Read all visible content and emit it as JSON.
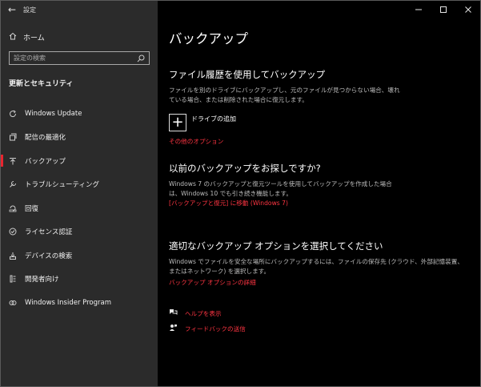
{
  "window": {
    "title": "設定"
  },
  "sidebar": {
    "home_label": "ホーム",
    "search_placeholder": "設定の検索",
    "section_title": "更新とセキュリティ",
    "items": [
      {
        "label": "Windows Update",
        "icon": "sync-icon"
      },
      {
        "label": "配信の最適化",
        "icon": "delivery-optimization-icon"
      },
      {
        "label": "バックアップ",
        "icon": "backup-arrow-icon",
        "active": true
      },
      {
        "label": "トラブルシューティング",
        "icon": "wrench-icon"
      },
      {
        "label": "回復",
        "icon": "recovery-icon"
      },
      {
        "label": "ライセンス認証",
        "icon": "check-circle-icon"
      },
      {
        "label": "デバイスの検索",
        "icon": "find-device-icon"
      },
      {
        "label": "開発者向け",
        "icon": "developer-icon"
      },
      {
        "label": "Windows Insider Program",
        "icon": "insider-icon"
      }
    ]
  },
  "main": {
    "page_title": "バックアップ",
    "file_history": {
      "heading": "ファイル履歴を使用してバックアップ",
      "description": "ファイルを別のドライブにバックアップし、元のファイルが見つからない場合、壊れている場合、または削除された場合に復元します。",
      "add_drive_label": "ドライブの追加",
      "more_options_link": "その他のオプション"
    },
    "older_backup": {
      "heading": "以前のバックアップをお探しですか?",
      "description": "Windows 7 のバックアップと復元ツールを使用してバックアップを作成した場合は、Windows 10 でも引き続き機能します。",
      "link": "[バックアップと復元] に移動 (Windows 7)"
    },
    "choose_option": {
      "heading": "適切なバックアップ オプションを選択してください",
      "description": "Windows でファイルを安全な場所にバックアップするには、ファイルの保存先 (クラウド、外部記憶装置、またはネットワーク) を選択します。",
      "link": "バックアップ オプションの詳細"
    },
    "help": {
      "get_help": "ヘルプを表示",
      "feedback": "フィードバックの送信"
    }
  },
  "colors": {
    "accent": "#ff3542",
    "sidebar_bg": "#2b2b2b",
    "main_bg": "#000000"
  }
}
